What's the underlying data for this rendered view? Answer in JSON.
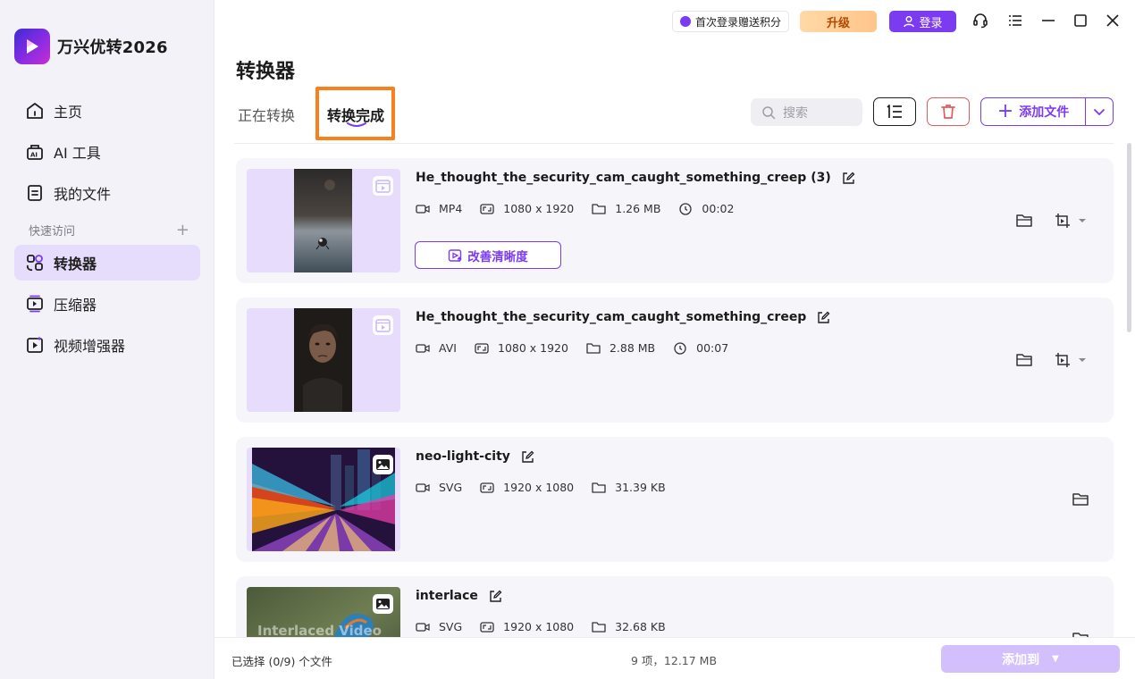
{
  "app": {
    "name": "万兴优转2026"
  },
  "topbar": {
    "promo": "首次登录赠送积分",
    "upgrade": "升级",
    "login": "登录"
  },
  "sidebar": {
    "items": [
      {
        "label": "主页",
        "icon": "home-icon"
      },
      {
        "label": "AI 工具",
        "icon": "ai-tools-icon"
      },
      {
        "label": "我的文件",
        "icon": "my-files-icon"
      }
    ],
    "quick_access": {
      "label": "快速访问",
      "add": "+"
    },
    "tools": [
      {
        "label": "转换器",
        "icon": "converter-icon",
        "active": true
      },
      {
        "label": "压缩器",
        "icon": "compressor-icon"
      },
      {
        "label": "视频增强器",
        "icon": "video-enhancer-icon"
      }
    ]
  },
  "main": {
    "title": "转换器",
    "tabs": [
      {
        "label": "正在转换"
      },
      {
        "label": "转换完成",
        "active": true
      }
    ],
    "search_placeholder": "搜索",
    "add_file": "添加文件"
  },
  "files": [
    {
      "name": "He_thought_the_security_cam_caught_something_creep (3)",
      "format": "MP4",
      "resolution": "1080 x 1920",
      "size": "1.26 MB",
      "duration": "00:02",
      "enhance_label": "改善清晰度",
      "type": "video"
    },
    {
      "name": "He_thought_the_security_cam_caught_something_creep",
      "format": "AVI",
      "resolution": "1080 x 1920",
      "size": "2.88 MB",
      "duration": "00:07",
      "type": "video"
    },
    {
      "name": "neo-light-city",
      "format": "SVG",
      "resolution": "1920 x 1080",
      "size": "31.39 KB",
      "type": "image"
    },
    {
      "name": "interlace",
      "format": "SVG",
      "resolution": "1920 x 1080",
      "size": "32.68 KB",
      "type": "image",
      "thumb_text": "Interlaced Video"
    }
  ],
  "bottombar": {
    "selected": "已选择 (0/9) 个文件",
    "summary": "9 项，12.17 MB",
    "add_to": "添加到"
  },
  "colors": {
    "accent": "#7b3bf1",
    "highlight": "#f7811c",
    "danger": "#e35b5b"
  }
}
